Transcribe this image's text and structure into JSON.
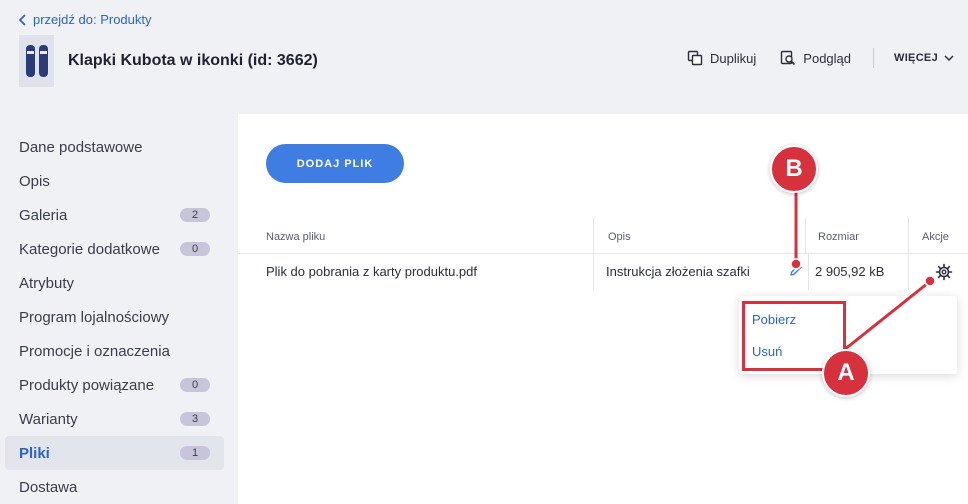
{
  "header": {
    "back_link": "przejdź do: Produkty",
    "product_title": "Klapki Kubota w ikonki (id: 3662)",
    "actions": {
      "duplicate": "Duplikuj",
      "preview": "Podgląd",
      "more": "WIĘCEJ"
    }
  },
  "sidebar": {
    "items": [
      {
        "label": "Dane podstawowe",
        "badge": null
      },
      {
        "label": "Opis",
        "badge": null
      },
      {
        "label": "Galeria",
        "badge": "2"
      },
      {
        "label": "Kategorie dodatkowe",
        "badge": "0"
      },
      {
        "label": "Atrybuty",
        "badge": null
      },
      {
        "label": "Program lojalnościowy",
        "badge": null
      },
      {
        "label": "Promocje i oznaczenia",
        "badge": null
      },
      {
        "label": "Produkty powiązane",
        "badge": "0"
      },
      {
        "label": "Warianty",
        "badge": "3"
      },
      {
        "label": "Pliki",
        "badge": "1",
        "active": true
      },
      {
        "label": "Dostawa",
        "badge": null
      }
    ]
  },
  "main": {
    "add_button": "DODAJ PLIK",
    "table": {
      "columns": [
        "Nazwa pliku",
        "Opis",
        "Rozmiar",
        "Akcje"
      ],
      "rows": [
        {
          "name": "Plik do pobrania z karty produktu.pdf",
          "description": "Instrukcja złożenia szafki",
          "size": "2 905,92 kB"
        }
      ]
    },
    "dropdown": [
      "Pobierz",
      "Usuń"
    ]
  },
  "callouts": {
    "a": "A",
    "b": "B"
  },
  "colors": {
    "accent": "#2d62c9",
    "button": "#3f7de3",
    "callout": "#d8313e",
    "badge": "#c8c5db"
  }
}
